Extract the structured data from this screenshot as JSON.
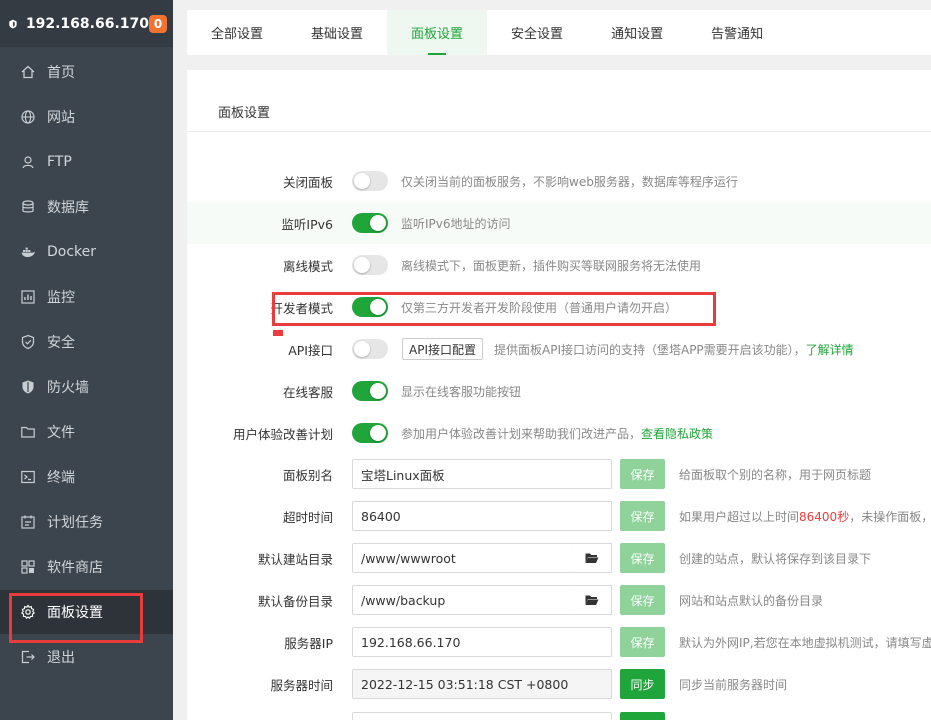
{
  "sidebar": {
    "host": "192.168.66.170",
    "badge": "0",
    "items": [
      {
        "label": "首页",
        "icon": "home-icon"
      },
      {
        "label": "网站",
        "icon": "globe-icon"
      },
      {
        "label": "FTP",
        "icon": "ftp-icon"
      },
      {
        "label": "数据库",
        "icon": "database-icon"
      },
      {
        "label": "Docker",
        "icon": "docker-icon"
      },
      {
        "label": "监控",
        "icon": "monitor-chart-icon"
      },
      {
        "label": "安全",
        "icon": "shield-icon"
      },
      {
        "label": "防火墙",
        "icon": "firewall-icon"
      },
      {
        "label": "文件",
        "icon": "folder-icon"
      },
      {
        "label": "终端",
        "icon": "terminal-icon"
      },
      {
        "label": "计划任务",
        "icon": "calendar-icon"
      },
      {
        "label": "软件商店",
        "icon": "store-icon"
      },
      {
        "label": "面板设置",
        "icon": "gear-icon"
      },
      {
        "label": "退出",
        "icon": "logout-icon"
      }
    ],
    "active_index": 12
  },
  "tabs": [
    "全部设置",
    "基础设置",
    "面板设置",
    "安全设置",
    "通知设置",
    "告警通知"
  ],
  "active_tab": 2,
  "panel": {
    "title": "面板设置",
    "toggles": [
      {
        "label": "关闭面板",
        "on": false,
        "desc": "仅关闭当前的面板服务，不影响web服务器，数据库等程序运行"
      },
      {
        "label": "监听IPv6",
        "on": true,
        "desc": "监听IPv6地址的访问"
      },
      {
        "label": "离线模式",
        "on": false,
        "desc": "离线模式下，面板更新，插件购买等联网服务将无法使用"
      },
      {
        "label": "开发者模式",
        "on": true,
        "desc": "仅第三方开发者开发阶段使用（普通用户请勿开启）"
      },
      {
        "label": "API接口",
        "on": false,
        "button": "API接口配置",
        "desc": "提供面板API接口访问的支持（堡塔APP需要开启该功能），",
        "link": "了解详情"
      },
      {
        "label": "在线客服",
        "on": true,
        "desc": "显示在线客服功能按钮"
      },
      {
        "label": "用户体验改善计划",
        "on": true,
        "desc": "参加用户体验改善计划来帮助我们改进产品，",
        "link": "查看隐私政策"
      }
    ],
    "fields": [
      {
        "label": "面板别名",
        "value": "宝塔Linux面板",
        "button": "保存",
        "desc": "给面板取个别的名称，用于网页标题"
      },
      {
        "label": "超时时间",
        "value": "86400",
        "button": "保存",
        "desc_pre": "如果用户超过以上时间",
        "desc_hl": "86400秒",
        "desc_post": "，未操作面板，"
      },
      {
        "label": "默认建站目录",
        "value": "/www/wwwroot",
        "button": "保存",
        "desc": "创建的站点，默认将保存到该目录下"
      },
      {
        "label": "默认备份目录",
        "value": "/www/backup",
        "button": "保存",
        "desc": "网站和站点默认的备份目录"
      },
      {
        "label": "服务器IP",
        "value": "192.168.66.170",
        "button": "保存",
        "desc": "默认为外网IP,若您在本地虚拟机测试，请填写虚"
      },
      {
        "label": "服务器时间",
        "value": "2022-12-15 03:51:18 CST +0800",
        "button": "同步",
        "desc": "同步当前服务器时间"
      }
    ]
  },
  "colors": {
    "accent": "#20a53a",
    "sidebar": "#3c444d",
    "highlight": "#e93d3d"
  }
}
